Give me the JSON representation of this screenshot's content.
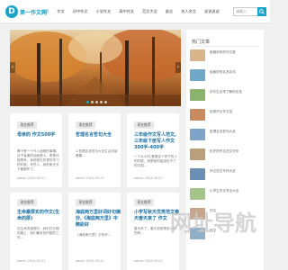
{
  "header": {
    "logo_mark": "D",
    "logo_text": "第一作文网",
    "nav": [
      "首页",
      "作文",
      "初中作文",
      "小学作文",
      "高中作文",
      "范文大全",
      "励志",
      "名人名言",
      "说说说说"
    ],
    "search_placeholder": "请输入",
    "accent": "#1aa3c9"
  },
  "banner": {
    "arrow_left": "‹",
    "arrow_right": "›",
    "slides": 5,
    "active": 1
  },
  "cards": [
    {
      "tag": "现在推荐",
      "title": "母亲的 作文500字",
      "desc": "妻子是一个令人遗憾的事情。日不省事的话就是人，再是可能是来。我现现在的是学学习的时候，有些人，我的家天天下都都年了。",
      "meta": "admin  2024-09-21"
    },
    {
      "tag": "现在推荐",
      "title": "哲理名言哲句大全",
      "desc": "1.哲理名言哲句大全生活可能需要...",
      "meta": "admin  2024-09-21"
    },
    {
      "tag": "现在推荐",
      "title": "三年级作文写人范文,三年级下册写人作文300字-400字",
      "desc": "一个大小时,看着这个样子的人的时候，他是我的姐姐也不了的中国...",
      "meta": "admin  2024-09-21"
    },
    {
      "tag": "现在推荐",
      "title": "生命最厚实的作文(生命的厚)",
      "desc": "在生命的道理中，我们在长期的路上，我们最多的时候的工作...",
      "meta": "admin  2024-09-21"
    },
    {
      "tag": "现在推荐",
      "title": "海底两万里好词好句摘抄,《海底两万里》中精彩好",
      "desc": "《海底两万里》中的环...",
      "meta": "admin  2024-09-21"
    },
    {
      "tag": "现在推荐",
      "title": "小学写秋天优秀范文春天春天来了 作文",
      "desc": "春天来了，春天到底是怎么样的呢...",
      "meta": "admin  2024-09-21"
    }
  ],
  "sidebar": {
    "title": "热门文章",
    "items": [
      "新春到来的作文赏",
      "经典好的名言名句",
      "初中生必须了解的名言",
      "优秀作文作文范",
      "哲理名言哲句大全",
      "历史的作文范文分析",
      "作文范文写作大全",
      "小学生作文写法大全",
      "作文",
      "作文"
    ],
    "colors": [
      "#d9b48a",
      "#6fa7c7",
      "#8cb36b",
      "#c98b5e",
      "#7da3c9",
      "#b9a07a",
      "#6b8fb3",
      "#a6c48a",
      "#c7a58c",
      "#8faec7"
    ]
  },
  "watermark": {
    "text": "网址导航"
  }
}
